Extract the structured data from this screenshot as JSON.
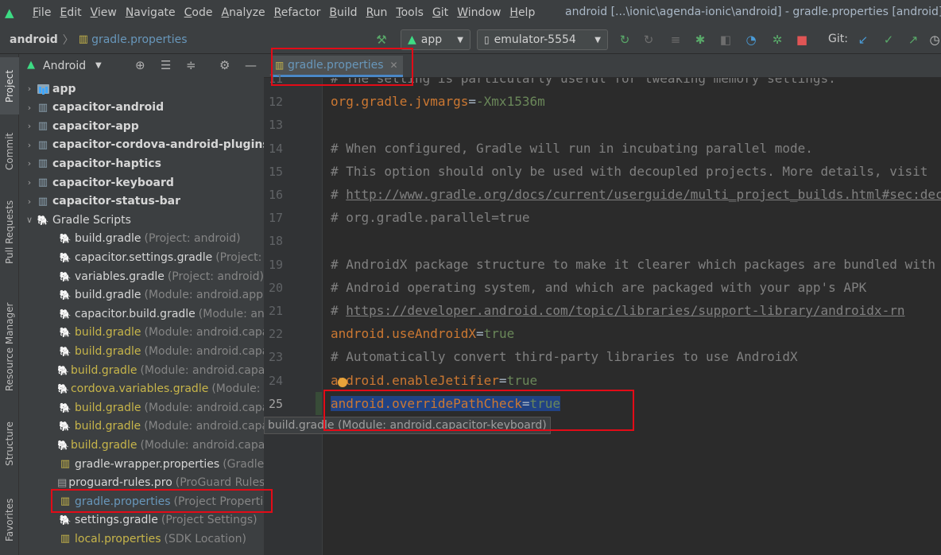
{
  "menubar": {
    "items": [
      "File",
      "Edit",
      "View",
      "Navigate",
      "Code",
      "Analyze",
      "Refactor",
      "Build",
      "Run",
      "Tools",
      "Git",
      "Window",
      "Help"
    ],
    "window_title": "android [...\\ionic\\agenda-ionic\\android] - gradle.properties [android]"
  },
  "toolbar": {
    "breadcrumb_project": "android",
    "breadcrumb_file": "gradle.properties",
    "run_config": "app",
    "device": "emulator-5554",
    "git_label": "Git:"
  },
  "left_tabs": [
    "Project",
    "Commit",
    "Pull Requests",
    "Resource Manager",
    "Structure",
    "Favorites"
  ],
  "project_panel": {
    "view_label": "Android",
    "tree": [
      {
        "label": "app",
        "hint": "",
        "style": "bold",
        "expandable": true,
        "expanded": false,
        "indent": 0,
        "icon": "folder"
      },
      {
        "label": "capacitor-android",
        "hint": "",
        "style": "bold",
        "expandable": true,
        "expanded": false,
        "indent": 0,
        "icon": "module"
      },
      {
        "label": "capacitor-app",
        "hint": "",
        "style": "bold",
        "expandable": true,
        "expanded": false,
        "indent": 0,
        "icon": "module"
      },
      {
        "label": "capacitor-cordova-android-plugins",
        "hint": "",
        "style": "bold",
        "expandable": true,
        "expanded": false,
        "indent": 0,
        "icon": "module"
      },
      {
        "label": "capacitor-haptics",
        "hint": "",
        "style": "bold",
        "expandable": true,
        "expanded": false,
        "indent": 0,
        "icon": "module"
      },
      {
        "label": "capacitor-keyboard",
        "hint": "",
        "style": "bold",
        "expandable": true,
        "expanded": false,
        "indent": 0,
        "icon": "module"
      },
      {
        "label": "capacitor-status-bar",
        "hint": "",
        "style": "bold",
        "expandable": true,
        "expanded": false,
        "indent": 0,
        "icon": "module"
      },
      {
        "label": "Gradle Scripts",
        "hint": "",
        "style": "normal",
        "expandable": true,
        "expanded": true,
        "indent": 0,
        "icon": "gradle"
      },
      {
        "label": "build.gradle",
        "hint": "(Project: android)",
        "style": "normal",
        "indent": 1,
        "icon": "gradle"
      },
      {
        "label": "capacitor.settings.gradle",
        "hint": "(Project: android)",
        "style": "normal",
        "indent": 1,
        "icon": "gradle"
      },
      {
        "label": "variables.gradle",
        "hint": "(Project: android)",
        "style": "normal",
        "indent": 1,
        "icon": "gradle"
      },
      {
        "label": "build.gradle",
        "hint": "(Module: android.app)",
        "style": "normal",
        "indent": 1,
        "icon": "gradle"
      },
      {
        "label": "capacitor.build.gradle",
        "hint": "(Module: android.app)",
        "style": "normal",
        "indent": 1,
        "icon": "gradle"
      },
      {
        "label": "build.gradle",
        "hint": "(Module: android.capacitor-android)",
        "style": "yellow",
        "indent": 1,
        "icon": "gradle"
      },
      {
        "label": "build.gradle",
        "hint": "(Module: android.capacitor-app)",
        "style": "yellow",
        "indent": 1,
        "icon": "gradle"
      },
      {
        "label": "build.gradle",
        "hint": "(Module: android.capacitor-cordova-android-plugins)",
        "style": "yellow",
        "indent": 1,
        "icon": "gradle"
      },
      {
        "label": "cordova.variables.gradle",
        "hint": "(Module: android.capacitor-cordova-android-plugins)",
        "style": "yellow",
        "indent": 1,
        "icon": "gradle"
      },
      {
        "label": "build.gradle",
        "hint": "(Module: android.capacitor-haptics)",
        "style": "yellow",
        "indent": 1,
        "icon": "gradle"
      },
      {
        "label": "build.gradle",
        "hint": "(Module: android.capacitor-keyboard)",
        "style": "yellow",
        "indent": 1,
        "icon": "gradle"
      },
      {
        "label": "build.gradle",
        "hint": "(Module: android.capacitor-status-bar)",
        "style": "yellow",
        "indent": 1,
        "icon": "gradle"
      },
      {
        "label": "gradle-wrapper.properties",
        "hint": "(Gradle Version)",
        "style": "normal",
        "indent": 1,
        "icon": "properties"
      },
      {
        "label": "proguard-rules.pro",
        "hint": "(ProGuard Rules for android.app)",
        "style": "normal",
        "indent": 1,
        "icon": "file"
      },
      {
        "label": "gradle.properties",
        "hint": "(Project Properties)",
        "style": "blue",
        "indent": 1,
        "icon": "properties"
      },
      {
        "label": "settings.gradle",
        "hint": "(Project Settings)",
        "style": "normal",
        "indent": 1,
        "icon": "gradle"
      },
      {
        "label": "local.properties",
        "hint": "(SDK Location)",
        "style": "yellow",
        "indent": 1,
        "icon": "properties"
      }
    ]
  },
  "editor": {
    "tab_label": "gradle.properties",
    "tooltip": "build.gradle (Module: android.capacitor-keyboard)",
    "lines": [
      {
        "no": "11",
        "parts": [
          {
            "t": "c",
            "s": "# The setting is particularly useful for tweaking memory settings."
          }
        ]
      },
      {
        "no": "12",
        "parts": [
          {
            "t": "k",
            "s": "org.gradle.jvmargs"
          },
          {
            "t": "eq",
            "s": "="
          },
          {
            "t": "v",
            "s": "-Xmx1536m"
          }
        ]
      },
      {
        "no": "13",
        "parts": []
      },
      {
        "no": "14",
        "parts": [
          {
            "t": "c",
            "s": "# When configured, Gradle will run in incubating parallel mode."
          }
        ]
      },
      {
        "no": "15",
        "parts": [
          {
            "t": "c",
            "s": "# This option should only be used with decoupled projects. More details, visit"
          }
        ]
      },
      {
        "no": "16",
        "parts": [
          {
            "t": "c",
            "s": "# "
          },
          {
            "t": "url",
            "s": "http://www.gradle.org/docs/current/userguide/multi_project_builds.html#sec:decoupled_projects"
          }
        ]
      },
      {
        "no": "17",
        "parts": [
          {
            "t": "c",
            "s": "# org.gradle.parallel=true"
          }
        ]
      },
      {
        "no": "18",
        "parts": []
      },
      {
        "no": "19",
        "parts": [
          {
            "t": "c",
            "s": "# AndroidX package structure to make it clearer which packages are bundled with the"
          }
        ]
      },
      {
        "no": "20",
        "parts": [
          {
            "t": "c",
            "s": "# Android operating system, and which are packaged with your app's APK"
          }
        ]
      },
      {
        "no": "21",
        "parts": [
          {
            "t": "c",
            "s": "# "
          },
          {
            "t": "url",
            "s": "https://developer.android.com/topic/libraries/support-library/androidx-rn"
          }
        ]
      },
      {
        "no": "22",
        "parts": [
          {
            "t": "k",
            "s": "android.useAndroidX"
          },
          {
            "t": "eq",
            "s": "="
          },
          {
            "t": "v",
            "s": "true"
          }
        ]
      },
      {
        "no": "23",
        "parts": [
          {
            "t": "c",
            "s": "# Automatically convert third-party libraries to use AndroidX"
          }
        ]
      },
      {
        "no": "24",
        "parts": [
          {
            "t": "k",
            "s": "android.enableJetifier"
          },
          {
            "t": "eq",
            "s": "="
          },
          {
            "t": "v",
            "s": "true"
          }
        ]
      },
      {
        "no": "25",
        "parts": [
          {
            "t": "k",
            "s": "android.overridePathCheck"
          },
          {
            "t": "eq",
            "s": "="
          },
          {
            "t": "v",
            "s": "true"
          }
        ],
        "selected": true,
        "current": true
      }
    ]
  },
  "colors": {
    "highlight_box": "#e30b17",
    "selection": "#214283",
    "keyword": "#cc7832",
    "value": "#6a8759",
    "comment": "#808080"
  }
}
